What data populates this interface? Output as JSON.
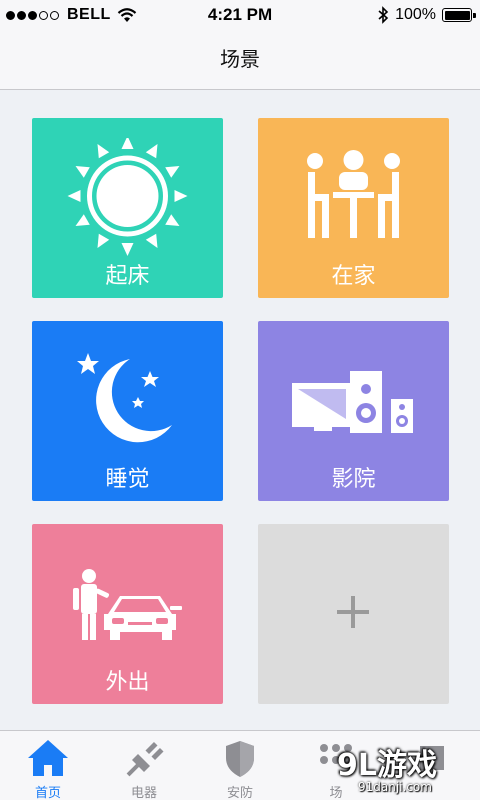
{
  "status_bar": {
    "carrier": "BELL",
    "time": "4:21 PM",
    "battery": "100%",
    "battery_level": 1.0,
    "signal_bars_filled": 3,
    "signal_bars_total": 5,
    "icons": [
      "signal-dots-icon",
      "wifi-icon",
      "bluetooth-icon",
      "battery-icon"
    ]
  },
  "nav": {
    "title": "场景"
  },
  "scenes": [
    {
      "label": "起床",
      "color": "#2fd3b6",
      "icon": "sun-icon"
    },
    {
      "label": "在家",
      "color": "#f9b656",
      "icon": "family-dining-icon"
    },
    {
      "label": "睡觉",
      "color": "#1a7cf5",
      "icon": "moon-stars-icon"
    },
    {
      "label": "影院",
      "color": "#8d84e3",
      "icon": "home-theater-icon"
    },
    {
      "label": "外出",
      "color": "#ee7f9a",
      "icon": "person-car-icon"
    },
    {
      "label": "",
      "color": "#dcdcdc",
      "icon": "plus-icon"
    }
  ],
  "tabs": [
    {
      "label": "首页",
      "icon": "home-icon",
      "active": true
    },
    {
      "label": "电器",
      "icon": "plug-icon",
      "active": false
    },
    {
      "label": "安防",
      "icon": "shield-icon",
      "active": false
    },
    {
      "label": "场",
      "icon": "grid-dots-icon",
      "active": false
    }
  ],
  "watermark": {
    "logo": "9L游戏",
    "url": "91danji.com"
  },
  "colors": {
    "accent": "#1a7cf5",
    "tab_inactive": "#8e8e93",
    "background": "#eef1f5"
  }
}
